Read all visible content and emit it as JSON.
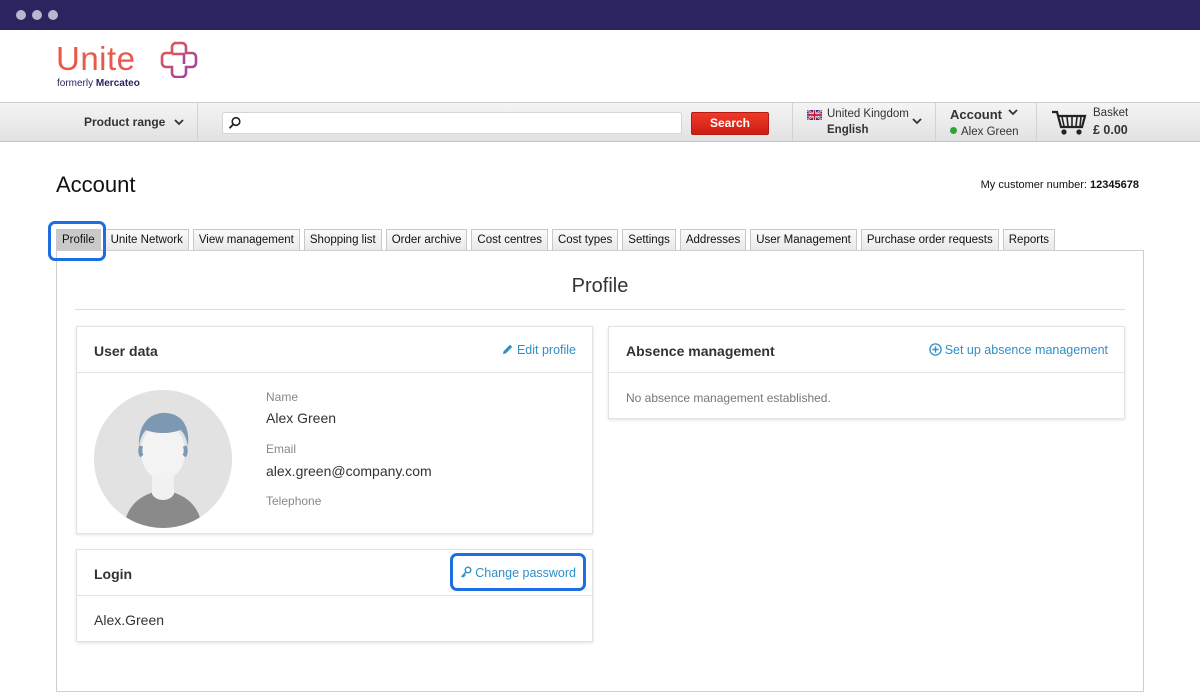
{
  "window": {
    "controls": [
      "close",
      "minimize",
      "maximize"
    ]
  },
  "logo": {
    "word": "Unite",
    "sub_prefix": "formerly",
    "sub_brand": "Mercateo"
  },
  "topbar": {
    "product_range": "Product range",
    "search": {
      "value": "",
      "button_label": "Search"
    },
    "locale": {
      "country": "United Kingdom",
      "language": "English"
    },
    "account": {
      "label": "Account",
      "user": "Alex Green",
      "status_color": "#2ea43a"
    },
    "basket": {
      "label": "Basket",
      "amount": "£ 0.00"
    }
  },
  "page": {
    "title": "Account",
    "customer_number_label": "My customer number:",
    "customer_number": "12345678"
  },
  "tabs": [
    {
      "label": "Profile",
      "active": true
    },
    {
      "label": "Unite Network"
    },
    {
      "label": "View management"
    },
    {
      "label": "Shopping list"
    },
    {
      "label": "Order archive"
    },
    {
      "label": "Cost centres"
    },
    {
      "label": "Cost types"
    },
    {
      "label": "Settings"
    },
    {
      "label": "Addresses"
    },
    {
      "label": "User Management"
    },
    {
      "label": "Purchase order requests"
    },
    {
      "label": "Reports"
    }
  ],
  "profile": {
    "heading": "Profile",
    "user_data": {
      "title": "User data",
      "edit_link": "Edit profile",
      "name_label": "Name",
      "name": "Alex Green",
      "email_label": "Email",
      "email": "alex.green@company.com",
      "telephone_label": "Telephone",
      "telephone": ""
    },
    "login": {
      "title": "Login",
      "change_password_link": "Change password",
      "username": "Alex.Green"
    },
    "absence": {
      "title": "Absence management",
      "setup_link": "Set up absence management",
      "empty_text": "No absence management established."
    }
  },
  "colors": {
    "chrome": "#2a2460",
    "brand": "#e8584c",
    "search_button": "#dc2a1d",
    "link": "#2f8fc8",
    "highlight": "#1c6fe0"
  }
}
